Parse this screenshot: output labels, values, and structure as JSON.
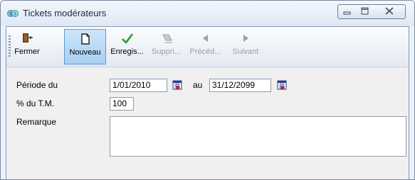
{
  "window": {
    "title": "Tickets modérateurs",
    "app_icon": "tickets-app-icon",
    "controls": [
      "minimize-icon",
      "maximize-icon",
      "close-icon"
    ]
  },
  "toolbar": {
    "items": [
      {
        "label": "Fermer",
        "icon": "exit-door-icon",
        "enabled": true,
        "active": false
      },
      {
        "label": "Nouveau",
        "icon": "new-document-icon",
        "enabled": true,
        "active": true
      },
      {
        "label": "Enregis...",
        "icon": "checkmark-icon",
        "enabled": true,
        "active": false
      },
      {
        "label": "Suppri...",
        "icon": "eraser-icon",
        "enabled": false,
        "active": false
      },
      {
        "label": "Précéd...",
        "icon": "arrow-left-icon",
        "enabled": false,
        "active": false
      },
      {
        "label": "Suivant",
        "icon": "arrow-right-icon",
        "enabled": false,
        "active": false
      }
    ]
  },
  "form": {
    "periode_label": "Période du",
    "date_from": "1/01/2010",
    "au_label": "au",
    "date_to": "31/12/2099",
    "tm_label": "% du T.M.",
    "tm_value": "100",
    "remarque_label": "Remarque",
    "remarque_value": ""
  },
  "colors": {
    "active_tool": "#a8cff2",
    "check_green": "#2e9a2e",
    "calendar_red": "#c8202a"
  }
}
